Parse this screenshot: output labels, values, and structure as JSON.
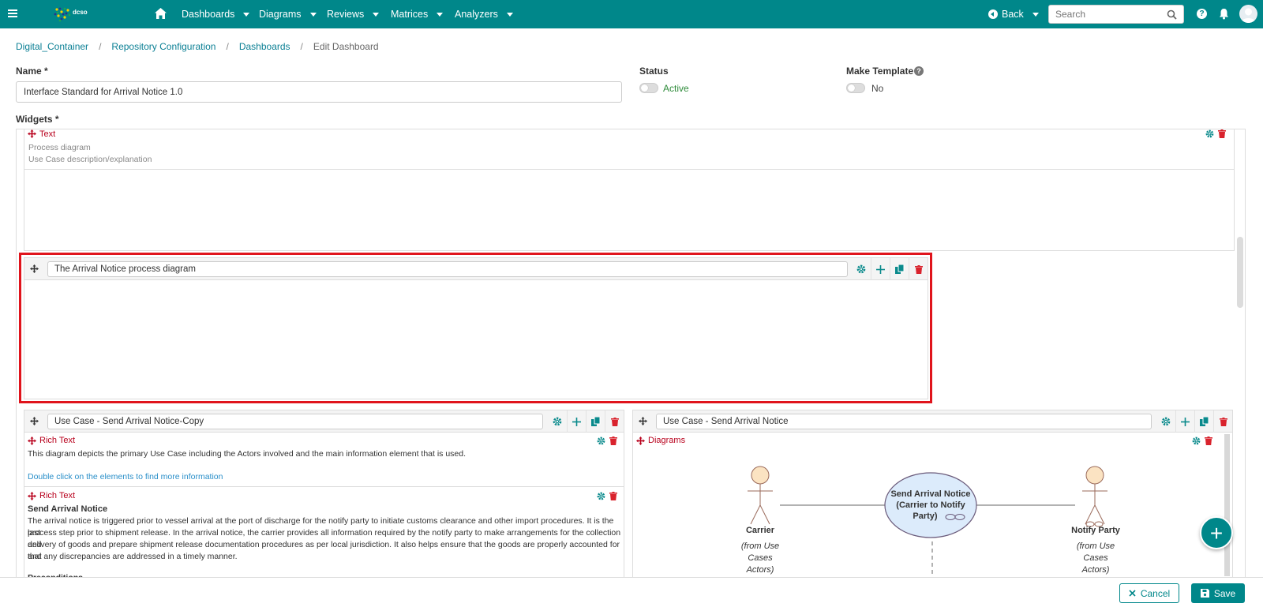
{
  "topbar": {
    "logo_text": "dcso",
    "nav": [
      "Dashboards",
      "Diagrams",
      "Reviews",
      "Matrices",
      "Analyzers"
    ],
    "back_label": "Back",
    "search_placeholder": "Search",
    "accent_color": "#00878a"
  },
  "breadcrumb": {
    "items": [
      "Digital_Container",
      "Repository Configuration",
      "Dashboards"
    ],
    "current": "Edit Dashboard",
    "separator": "/"
  },
  "form": {
    "name_label": "Name *",
    "name_value": "Interface Standard for Arrival Notice 1.0",
    "status_label": "Status",
    "status_value": "Active",
    "template_label": "Make Template",
    "template_value": "No",
    "widgets_label": "Widgets *"
  },
  "text_widget": {
    "title": "Text",
    "line1": "Process diagram",
    "line2": "Use Case description/explanation"
  },
  "highlight_panel": {
    "title": "The Arrival Notice process diagram"
  },
  "left_panel": {
    "title": "Use Case - Send Arrival Notice-Copy",
    "rich1_title": "Rich Text",
    "rich1_text": "This diagram depicts the primary Use Case including the Actors involved and the main information element that is used.",
    "rich1_link": "Double click on the elements to find more information",
    "rich2_title": "Rich Text",
    "rich2_heading": "Send Arrival Notice",
    "rich2_line1": "The arrival notice is triggered prior to vessel arrival at the port of discharge for the notify party to initiate customs clearance and other import procedures. It is the last",
    "rich2_line2": "process step prior to shipment release. In the arrival notice, the carrier provides all information required by the notify party to make arrangements for the collection and",
    "rich2_line3": "delivery of goods and prepare shipment release documentation procedures as per local jurisdiction. It also helps ensure that the goods are properly accounted for and",
    "rich2_line4": "that any discrepancies are addressed in a timely manner.",
    "rich2_more": "Preconditions"
  },
  "right_panel": {
    "title": "Use Case - Send Arrival Notice",
    "diagrams_title": "Diagrams",
    "diagram": {
      "actor_left": "Carrier",
      "actor_left_note": [
        "(from Use",
        "Cases",
        "Actors)"
      ],
      "actor_right": "Notify Party",
      "actor_right_note": [
        "(from Use",
        "Cases",
        "Actors)"
      ],
      "usecase_lines": [
        "Send Arrival Notice",
        "(Carrier to Notify",
        "Party)"
      ]
    }
  },
  "footer": {
    "cancel_label": "Cancel",
    "save_label": "Save"
  }
}
